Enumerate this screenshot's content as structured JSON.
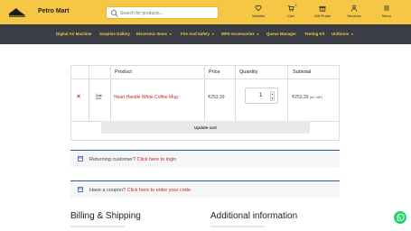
{
  "header": {
    "brand": "Petro Mart",
    "search_placeholder": "Search for products...",
    "items": [
      {
        "label": "Wishlist",
        "icon": "heart-icon"
      },
      {
        "label": "Cart",
        "icon": "cart-icon",
        "count": "1"
      },
      {
        "label": "Gift Finder",
        "icon": "gift-icon"
      },
      {
        "label": "Services",
        "icon": "services-icon"
      },
      {
        "label": "Menu",
        "icon": "menu-icon"
      }
    ],
    "accent_color": "#f6c744"
  },
  "nav": {
    "items": [
      {
        "label": "Digital Air Machine",
        "caret": false
      },
      {
        "label": "Surprise Gallery",
        "caret": false
      },
      {
        "label": "Electronic Items",
        "caret": true
      },
      {
        "label": "Fire And Safety",
        "caret": true
      },
      {
        "label": "MPD Accessories",
        "caret": true
      },
      {
        "label": "Queue Manager",
        "caret": false
      },
      {
        "label": "Testing Kit",
        "caret": false
      },
      {
        "label": "Uniforms",
        "caret": true
      }
    ]
  },
  "cart": {
    "columns": [
      "Product",
      "Price",
      "Quantity",
      "Subtotal"
    ],
    "rows": [
      {
        "remove": "×",
        "product": "Heart Handle White Coffee Mug",
        "price": "₹253.39",
        "quantity": "1",
        "subtotal": "₹253.39",
        "tax_note": "(ex. VAT)"
      }
    ],
    "update_label": "Update cart"
  },
  "notices": {
    "returning_text": "Returning customer?",
    "returning_link": "Click here to login",
    "coupon_text": "Have a coupon?",
    "coupon_link": "Click here to enter your code"
  },
  "sections": {
    "billing_title": "Billing & Shipping",
    "additional_title": "Additional information"
  }
}
